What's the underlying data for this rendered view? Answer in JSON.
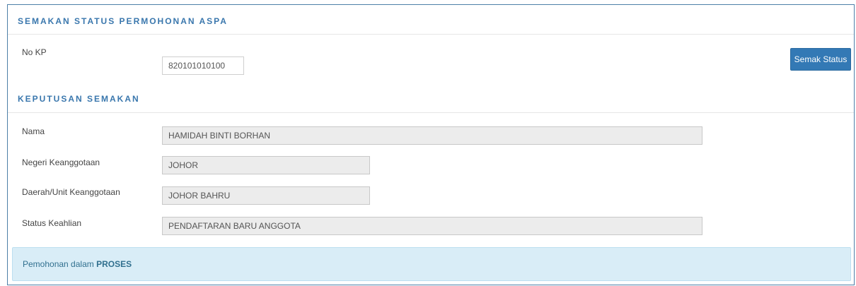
{
  "check_section": {
    "title": "SEMAKAN STATUS PERMOHONAN ASPA",
    "no_kp_label": "No KP",
    "no_kp_value": "820101010100",
    "submit_label": "Semak Status"
  },
  "result_section": {
    "title": "KEPUTUSAN SEMAKAN",
    "fields": [
      {
        "label": "Nama",
        "value": "HAMIDAH BINTI BORHAN"
      },
      {
        "label": "Negeri Keanggotaan",
        "value": "JOHOR"
      },
      {
        "label": "Daerah/Unit Keanggotaan",
        "value": "JOHOR BAHRU"
      },
      {
        "label": "Status Keahlian",
        "value": "PENDAFTARAN BARU ANGGOTA"
      }
    ]
  },
  "alert": {
    "prefix": "Pemohonan dalam",
    "status": "PROSES"
  }
}
